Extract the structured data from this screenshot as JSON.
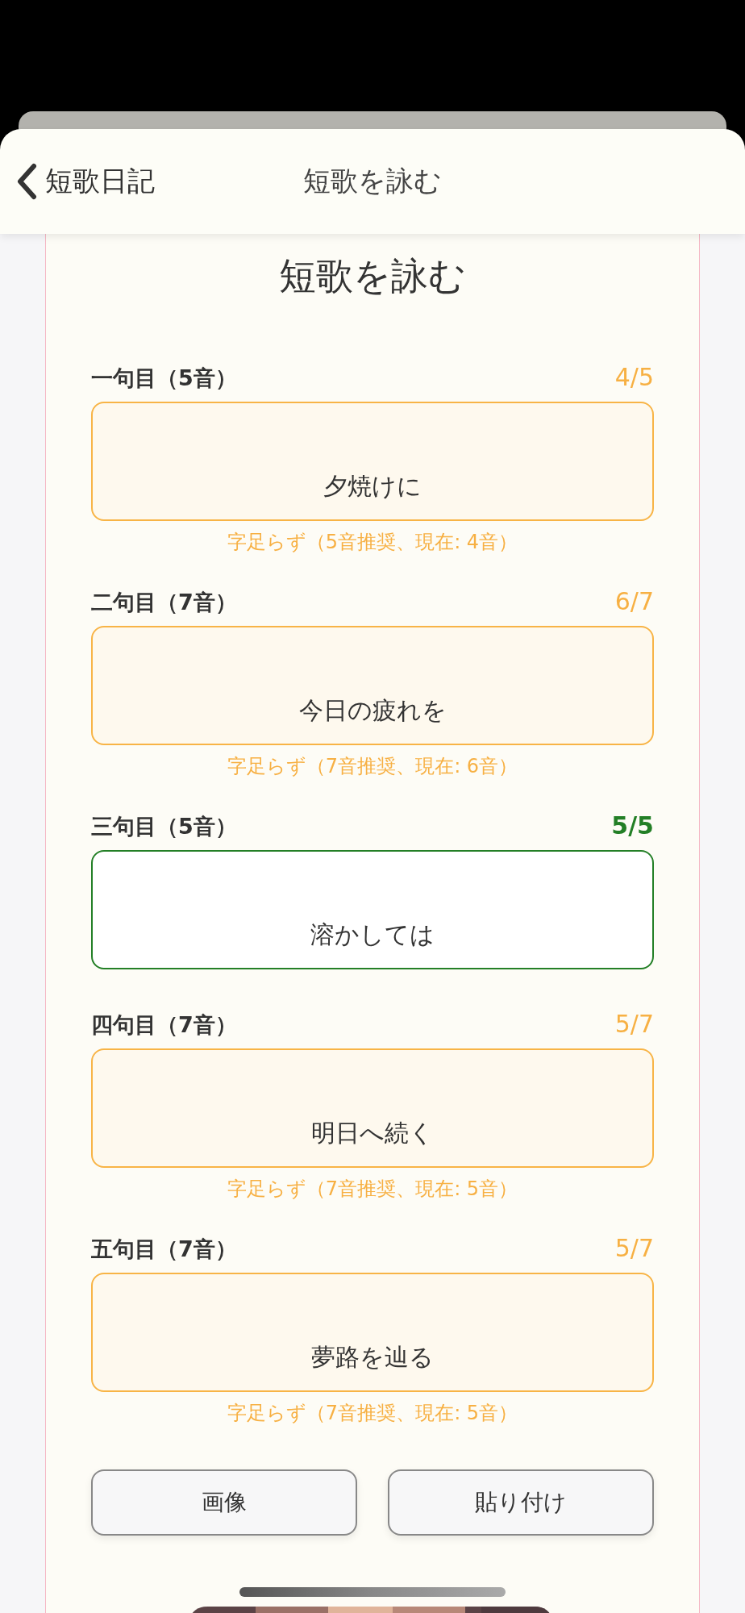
{
  "nav": {
    "back_label": "短歌日記",
    "title": "短歌を詠む"
  },
  "heading": "短歌を詠む",
  "verses": [
    {
      "label": "一句目（5音）",
      "count": "4/5",
      "complete": false,
      "value": "夕焼けに",
      "hint": "字足らず（5音推奨、現在: 4音）"
    },
    {
      "label": "二句目（7音）",
      "count": "6/7",
      "complete": false,
      "value": "今日の疲れを",
      "hint": "字足らず（7音推奨、現在: 6音）"
    },
    {
      "label": "三句目（5音）",
      "count": "5/5",
      "complete": true,
      "value": "溶かしては"
    },
    {
      "label": "四句目（7音）",
      "count": "5/7",
      "value": "明日へ続く",
      "complete": false,
      "hint": "字足らず（7音推奨、現在: 5音）"
    },
    {
      "label": "五句目（7音）",
      "count": "5/7",
      "value": "夢路を辿る",
      "complete": false,
      "hint": "字足らず（7音推奨、現在: 5音）"
    }
  ],
  "buttons": [
    "画像",
    "貼り付け"
  ]
}
